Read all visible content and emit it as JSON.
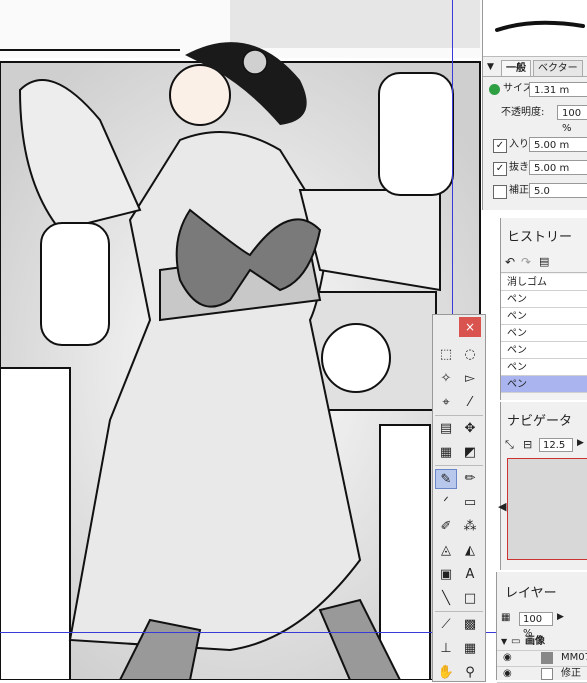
{
  "brush_panel": {
    "tabs": [
      "一般",
      "ベクター"
    ],
    "props": {
      "size_label": "サイズ:",
      "size_value": "1.31 m",
      "opacity_label": "不透明度:",
      "opacity_value": "100 %",
      "in_label": "入り:",
      "in_value": "5.00 m",
      "out_label": "抜き:",
      "out_value": "5.00 m",
      "correct_label": "補正:",
      "correct_value": "5.0"
    }
  },
  "history": {
    "title": "ヒストリー",
    "items": [
      "消しゴム",
      "ペン",
      "ペン",
      "ペン",
      "ペン",
      "ペン",
      "ペン"
    ],
    "selected_index": 6
  },
  "navigator": {
    "title": "ナビゲータ",
    "zoom": "12.5"
  },
  "layers": {
    "title": "レイヤー",
    "opacity": "100 %",
    "folder_name": "画像",
    "layer_name": "MM07",
    "layer2_name": "修正"
  },
  "toolbox": {
    "close_glyph": "×"
  },
  "colors": {
    "guide": "#3a3ad8",
    "history_selected": "#aab4ee",
    "close_button": "#d9534f"
  }
}
